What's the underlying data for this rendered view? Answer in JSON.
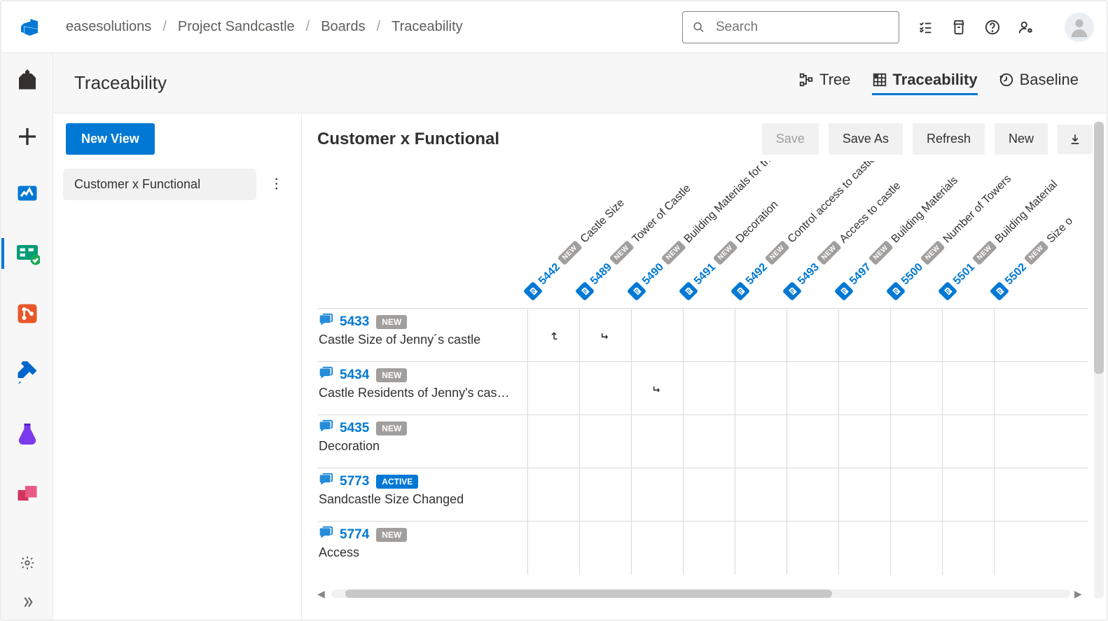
{
  "breadcrumb": {
    "org": "easesolutions",
    "project": "Project Sandcastle",
    "area": "Boards",
    "page": "Traceability"
  },
  "search": {
    "placeholder": "Search"
  },
  "page": {
    "title": "Traceability",
    "view_tabs": {
      "tree": "Tree",
      "traceability": "Traceability",
      "baseline": "Baseline"
    }
  },
  "sidebar": {
    "new_view": "New View",
    "views": [
      "Customer x Functional"
    ]
  },
  "matrix": {
    "title": "Customer x Functional",
    "buttons": {
      "save": "Save",
      "save_as": "Save As",
      "refresh": "Refresh",
      "new": "New"
    },
    "columns": [
      {
        "id": "5442",
        "name": "Castle Size",
        "badge": "NEW"
      },
      {
        "id": "5489",
        "name": "Tower of Castle",
        "badge": "NEW"
      },
      {
        "id": "5490",
        "name": "Building Materials for the castle",
        "badge": "NEW"
      },
      {
        "id": "5491",
        "name": "Decoration",
        "badge": "NEW"
      },
      {
        "id": "5492",
        "name": "Control access to castle by sec…",
        "badge": "NEW"
      },
      {
        "id": "5493",
        "name": "Access to castle",
        "badge": "NEW"
      },
      {
        "id": "5497",
        "name": "Building Materials",
        "badge": "NEW"
      },
      {
        "id": "5500",
        "name": "Number of Towers",
        "badge": "NEW"
      },
      {
        "id": "5501",
        "name": "Building Material",
        "badge": "NEW"
      },
      {
        "id": "5502",
        "name": "Size o",
        "badge": "NEW"
      }
    ],
    "rows": [
      {
        "id": "5433",
        "name": "Castle Size of Jenny´s castle",
        "status": "NEW",
        "status_type": "new",
        "links": {
          "0": "up",
          "1": "down"
        }
      },
      {
        "id": "5434",
        "name": "Castle Residents of Jenny's cas…",
        "status": "NEW",
        "status_type": "new",
        "links": {
          "2": "down"
        }
      },
      {
        "id": "5435",
        "name": "Decoration",
        "status": "NEW",
        "status_type": "new",
        "links": {}
      },
      {
        "id": "5773",
        "name": "Sandcastle Size Changed",
        "status": "ACTIVE",
        "status_type": "active",
        "links": {}
      },
      {
        "id": "5774",
        "name": "Access",
        "status": "NEW",
        "status_type": "new",
        "links": {}
      }
    ]
  }
}
